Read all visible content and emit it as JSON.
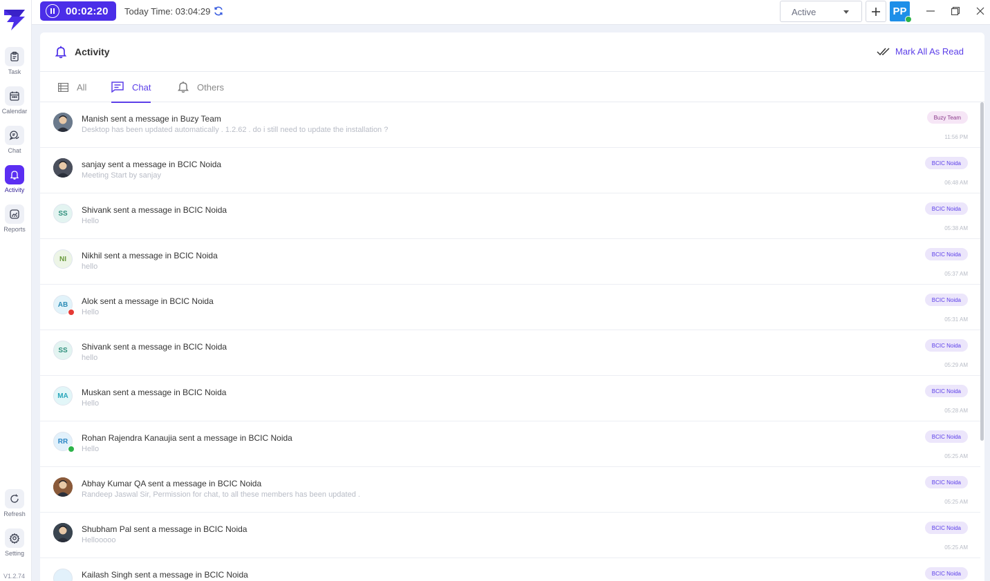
{
  "sidebar": {
    "logo": "buzy-logo",
    "items": [
      {
        "label": "Task",
        "icon": "clipboard-icon",
        "active": false
      },
      {
        "label": "Calendar",
        "icon": "calendar-icon",
        "active": false
      },
      {
        "label": "Chat",
        "icon": "chat-icon",
        "active": false
      },
      {
        "label": "Activity",
        "icon": "bell-icon",
        "active": true
      },
      {
        "label": "Reports",
        "icon": "reports-icon",
        "active": false
      }
    ],
    "bottom": [
      {
        "label": "Refresh",
        "icon": "refresh-icon"
      },
      {
        "label": "Setting",
        "icon": "gear-icon"
      }
    ],
    "version": "V1.2.74"
  },
  "topbar": {
    "timer": "00:02:20",
    "today_time": "Today Time: 03:04:29",
    "status": "Active",
    "user_initials": "PP",
    "accent": "#4b2ee8"
  },
  "activity": {
    "title": "Activity",
    "mark_all_read": "Mark All As Read",
    "tabs": [
      {
        "label": "All",
        "icon": "list-icon",
        "active": false
      },
      {
        "label": "Chat",
        "icon": "message-icon",
        "active": true
      },
      {
        "label": "Others",
        "icon": "bell-icon",
        "active": false
      }
    ],
    "items": [
      {
        "title": "Manish sent a message in Buzy Team",
        "subtitle": "Desktop has been updated automatically . 1.2.62 . do i still need to update the installation ?",
        "badge": "Buzy Team",
        "time": "11:56 PM",
        "avatar": {
          "type": "photo",
          "initials": "",
          "bg": "#6b7a8c",
          "fg": "#fff"
        }
      },
      {
        "title": "sanjay sent a message in BCIC Noida",
        "subtitle": "Meeting Start by sanjay",
        "badge": "BCIC Noida",
        "time": "06:48 AM",
        "avatar": {
          "type": "photo",
          "initials": "",
          "bg": "#4a4f5c",
          "fg": "#fff"
        }
      },
      {
        "title": "Shivank sent a message in BCIC Noida",
        "subtitle": "Hello",
        "badge": "BCIC Noida",
        "time": "05:38 AM",
        "avatar": {
          "type": "initials",
          "initials": "SS",
          "bg": "#e3f4f1",
          "fg": "#2f8f7c"
        }
      },
      {
        "title": "Nikhil sent a message in BCIC Noida",
        "subtitle": "hello",
        "badge": "BCIC Noida",
        "time": "05:37 AM",
        "avatar": {
          "type": "initials",
          "initials": "NI",
          "bg": "#edf5e6",
          "fg": "#6a9a3c"
        }
      },
      {
        "title": "Alok sent a message in BCIC Noida",
        "subtitle": "Hello",
        "badge": "BCIC Noida",
        "time": "05:31 AM",
        "avatar": {
          "type": "initials",
          "initials": "AB",
          "bg": "#e2f3fa",
          "fg": "#2a8bb5",
          "dot": "#e53935"
        }
      },
      {
        "title": "Shivank sent a message in BCIC Noida",
        "subtitle": "hello",
        "badge": "BCIC Noida",
        "time": "05:29 AM",
        "avatar": {
          "type": "initials",
          "initials": "SS",
          "bg": "#e3f4f1",
          "fg": "#2f8f7c"
        }
      },
      {
        "title": "Muskan sent a message in BCIC Noida",
        "subtitle": "Hello",
        "badge": "BCIC Noida",
        "time": "05:28 AM",
        "avatar": {
          "type": "initials",
          "initials": "MA",
          "bg": "#e2f6f8",
          "fg": "#2aa7bb"
        }
      },
      {
        "title": "Rohan Rajendra Kanaujia sent a message in BCIC Noida",
        "subtitle": "Hello",
        "badge": "BCIC Noida",
        "time": "05:25 AM",
        "avatar": {
          "type": "initials",
          "initials": "RR",
          "bg": "#e2f1fb",
          "fg": "#2a86c5",
          "dot": "#2db34a"
        }
      },
      {
        "title": "Abhay Kumar QA sent a message in BCIC Noida",
        "subtitle": "Randeep Jaswal Sir, Permission for chat, to all these members has been updated .",
        "badge": "BCIC Noida",
        "time": "05:25 AM",
        "avatar": {
          "type": "photo",
          "initials": "",
          "bg": "#8a5a3a",
          "fg": "#fff"
        }
      },
      {
        "title": "Shubham Pal sent a message in BCIC Noida",
        "subtitle": "Hellooooo",
        "badge": "BCIC Noida",
        "time": "05:25 AM",
        "avatar": {
          "type": "photo",
          "initials": "",
          "bg": "#3a4550",
          "fg": "#fff"
        }
      },
      {
        "title": "Kailash Singh sent a message in BCIC Noida",
        "subtitle": "",
        "badge": "BCIC Noida",
        "time": "",
        "avatar": {
          "type": "initials",
          "initials": "",
          "bg": "#e2f1fb",
          "fg": "#2a86c5"
        }
      }
    ],
    "badge_colors": {
      "Buzy Team": {
        "bg": "#f6e6f6",
        "fg": "#8a3a8a"
      },
      "BCIC Noida": {
        "bg": "#ece6fb",
        "fg": "#5b3ee8"
      }
    }
  }
}
